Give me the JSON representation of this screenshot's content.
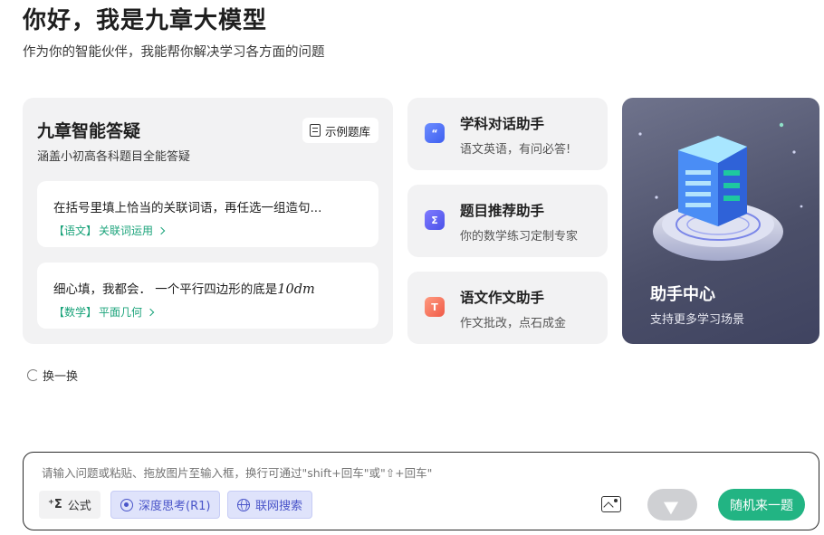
{
  "greeting": {
    "title": "你好，我是九章大模型",
    "subtitle": "作为你的智能伙伴，我能帮你解决学习各方面的问题"
  },
  "qa_card": {
    "title": "九章智能答疑",
    "subtitle": "涵盖小初高各科题目全能答疑",
    "example_bank_label": "示例题库",
    "examples": [
      {
        "text": "在括号里填上恰当的关联词语，再任选一组造句...",
        "math": "",
        "subject": "【语文】",
        "topic": "关联词运用"
      },
      {
        "text": "细心填，我都会． 一个平行四边形的底是",
        "math": "10dm",
        "subject": "【数学】",
        "topic": "平面几何"
      }
    ]
  },
  "assistants": [
    {
      "title": "学科对话助手",
      "subtitle": "语文英语，有问必答!",
      "icon": "chat-bubble-icon",
      "color": "#4f6ff5"
    },
    {
      "title": "题目推荐助手",
      "subtitle": "你的数学练习定制专家",
      "icon": "sigma-icon",
      "color": "#5a5ef0"
    },
    {
      "title": "语文作文助手",
      "subtitle": "作文批改，点石成金",
      "icon": "text-T-icon",
      "color": "#f26a55"
    }
  ],
  "hub": {
    "title": "助手中心",
    "subtitle": "支持更多学习场景"
  },
  "refresh_label": "换一换",
  "input": {
    "placeholder": "请输入问题或粘贴、拖放图片至输入框，换行可通过\"shift+回车\"或\"⇧+回车\"",
    "formula_label": "公式",
    "deep_think_label": "深度思考(R1)",
    "web_search_label": "联网搜索",
    "random_label": "随机来一题"
  },
  "colors": {
    "accent_green": "#22b483",
    "tag_green": "#1aa37a",
    "toggle_blue": "#4a55c9"
  }
}
